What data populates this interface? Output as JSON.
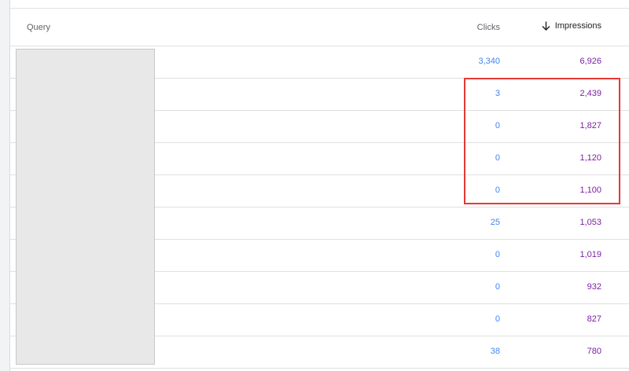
{
  "table": {
    "headers": {
      "query": "Query",
      "clicks": "Clicks",
      "impressions": "Impressions"
    },
    "sort": {
      "column": "impressions",
      "direction": "descending",
      "icon": "arrow-down-icon"
    },
    "rows": [
      {
        "query": "",
        "clicks": "3,340",
        "impressions": "6,926"
      },
      {
        "query": "",
        "clicks": "3",
        "impressions": "2,439"
      },
      {
        "query": "",
        "clicks": "0",
        "impressions": "1,827"
      },
      {
        "query": "",
        "clicks": "0",
        "impressions": "1,120"
      },
      {
        "query": "",
        "clicks": "0",
        "impressions": "1,100"
      },
      {
        "query": "",
        "clicks": "25",
        "impressions": "1,053"
      },
      {
        "query": "",
        "clicks": "0",
        "impressions": "1,019"
      },
      {
        "query": "",
        "clicks": "0",
        "impressions": "932"
      },
      {
        "query": "",
        "clicks": "0",
        "impressions": "827"
      },
      {
        "query": "",
        "clicks": "38",
        "impressions": "780"
      }
    ]
  },
  "colors": {
    "clicks": "#4285f4",
    "impressions": "#7b1fa2",
    "highlight": "#e53935",
    "redaction": "#e8e8e8"
  },
  "annotations": {
    "highlighted_rows": [
      2,
      3,
      4,
      5
    ],
    "query_column_redacted": true
  }
}
